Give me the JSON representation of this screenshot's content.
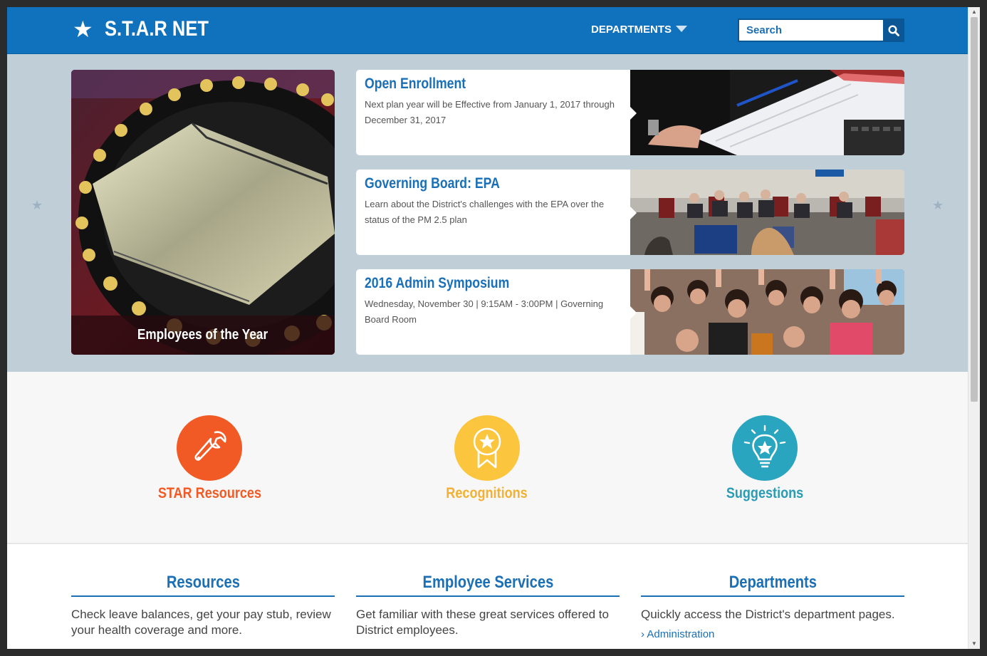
{
  "header": {
    "brand": "S.T.A.R NET",
    "nav_departments": "DEPARTMENTS",
    "search_placeholder": "Search"
  },
  "hero": {
    "feature_caption": "Employees of the Year",
    "cards": [
      {
        "title": "Open Enrollment",
        "body": "Next plan year will be Effective from January 1, 2017 through December 31, 2017"
      },
      {
        "title": "Governing Board: EPA",
        "body": "Learn about the District's challenges with the EPA over the status of the PM 2.5 plan"
      },
      {
        "title": "2016 Admin Symposium",
        "body": "Wednesday, November 30 | 9:15AM - 3:00PM | Governing Board Room"
      }
    ]
  },
  "quick_links": [
    {
      "label": "STAR Resources",
      "color": "#f15a24"
    },
    {
      "label": "Recognitions",
      "color": "#fbc53e"
    },
    {
      "label": "Suggestions",
      "color": "#2aa5bf"
    }
  ],
  "columns": [
    {
      "title": "Resources",
      "body": "Check leave balances, get your pay stub, review your health coverage and more."
    },
    {
      "title": "Employee Services",
      "body": "Get familiar with these great services offered to District employees."
    },
    {
      "title": "Departments",
      "body": "Quickly access the District's department pages.",
      "link": "Administration"
    }
  ]
}
